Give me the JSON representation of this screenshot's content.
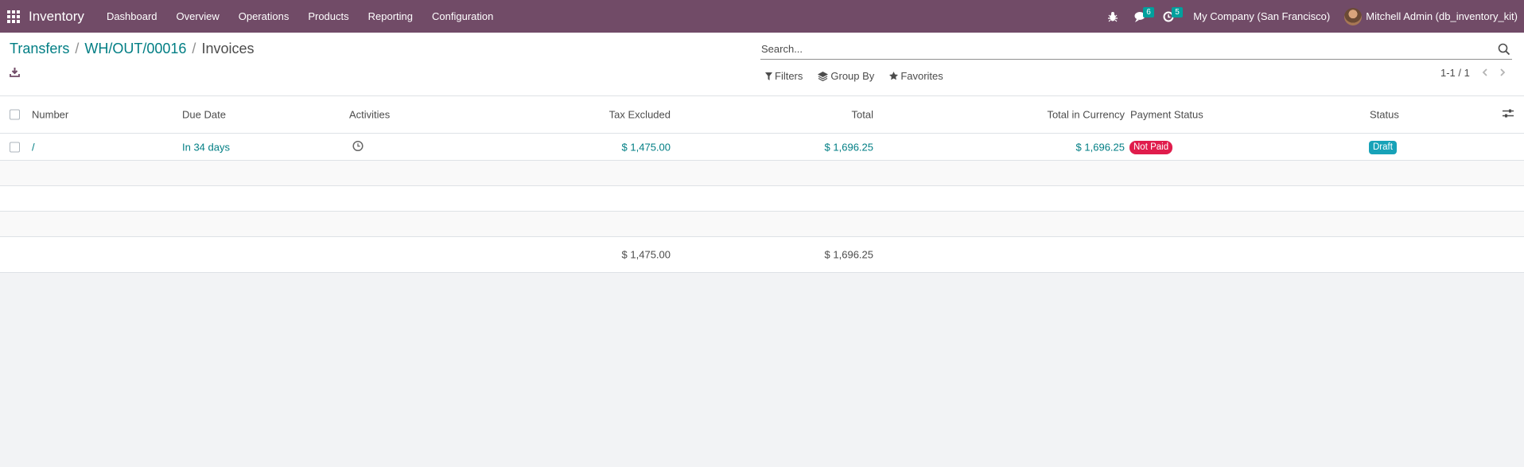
{
  "navbar": {
    "app_name": "Inventory",
    "menu": [
      "Dashboard",
      "Overview",
      "Operations",
      "Products",
      "Reporting",
      "Configuration"
    ],
    "messages_count": "6",
    "activities_count": "5",
    "company": "My Company (San Francisco)",
    "user": "Mitchell Admin (db_inventory_kit)"
  },
  "breadcrumb": {
    "items": [
      "Transfers",
      "WH/OUT/00016"
    ],
    "current": "Invoices",
    "separator": "/"
  },
  "search": {
    "placeholder": "Search..."
  },
  "filters": {
    "filters_label": "Filters",
    "group_by_label": "Group By",
    "favorites_label": "Favorites"
  },
  "pager": {
    "text": "1-1 / 1"
  },
  "table": {
    "columns": [
      "Number",
      "Due Date",
      "Activities",
      "Tax Excluded",
      "Total",
      "Total in Currency",
      "Payment Status",
      "Status"
    ],
    "rows": [
      {
        "number": "/",
        "due_date": "In 34 days",
        "tax_excluded": "$ 1,475.00",
        "total": "$ 1,696.25",
        "total_currency": "$ 1,696.25",
        "payment_status": "Not Paid",
        "status": "Draft"
      }
    ],
    "totals": {
      "tax_excluded": "$ 1,475.00",
      "total": "$ 1,696.25"
    }
  },
  "colors": {
    "brand": "#714b67",
    "link": "#017e84",
    "not_paid": "#e01c4c",
    "draft": "#17a2b8"
  }
}
